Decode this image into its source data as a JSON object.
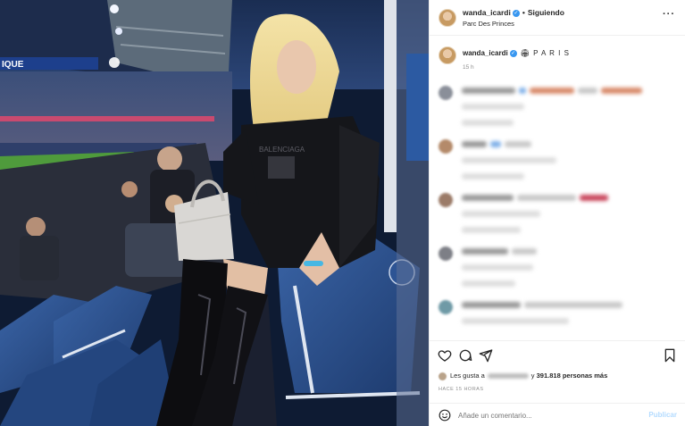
{
  "header": {
    "username": "wanda_icardi",
    "separator": "•",
    "follow_status": "Siguiendo",
    "location": "Parc Des Princes",
    "more": "···"
  },
  "caption": {
    "username": "wanda_icardi",
    "verified_mark": "✓",
    "text": "🏟 P A R I S",
    "time": "15 h"
  },
  "stadium_banner": "IQUE",
  "actions": {
    "likes_prefix": "Les gusta a",
    "likes_suffix": "391.818 personas más",
    "time_ago": "HACE 15 HORAS"
  },
  "comment_box": {
    "placeholder": "Añade un comentario...",
    "post_label": "Publicar"
  },
  "icons": [
    "heart-icon",
    "comment-icon",
    "share-icon",
    "bookmark-icon",
    "emoji-icon",
    "more-icon",
    "verified-icon"
  ],
  "colors": {
    "accent_link": "#3897f0",
    "post_disabled": "#b3dbff",
    "stadium_seat": "#2b4f86",
    "pitch": "#4f9b3c"
  }
}
